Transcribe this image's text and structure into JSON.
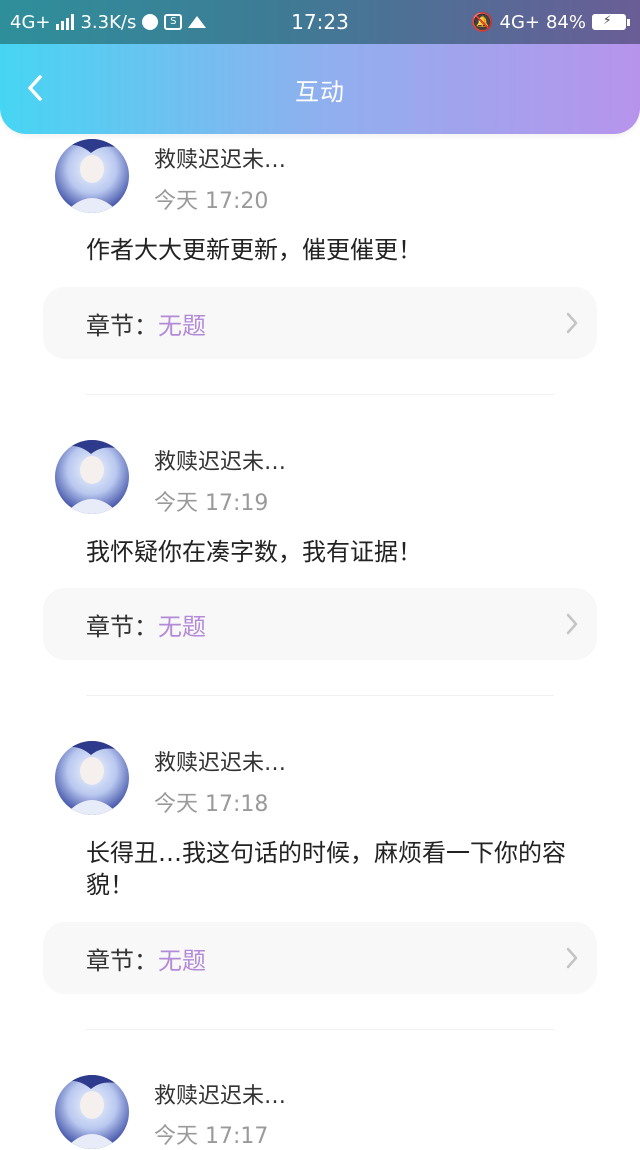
{
  "status_bar": {
    "network_left": "4G+",
    "speed": "3.3K/s",
    "time": "17:23",
    "network_right": "4G+",
    "battery": "84%"
  },
  "header": {
    "title": "互动"
  },
  "chapter_label": "章节：",
  "items": [
    {
      "name": "救赎迟迟未…",
      "time": "今天 17:20",
      "content": "作者大大更新更新，催更催更！",
      "chapter": "无题"
    },
    {
      "name": "救赎迟迟未…",
      "time": "今天 17:19",
      "content": "我怀疑你在凑字数，我有证据！",
      "chapter": "无题"
    },
    {
      "name": "救赎迟迟未…",
      "time": "今天 17:18",
      "content": "长得丑…我这句话的时候，麻烦看一下你的容貌！",
      "chapter": "无题"
    },
    {
      "name": "救赎迟迟未…",
      "time": "今天 17:17"
    }
  ],
  "colors": {
    "accent": "#b38ad8",
    "header_start": "#46d5f3",
    "header_end": "#b794ec"
  }
}
